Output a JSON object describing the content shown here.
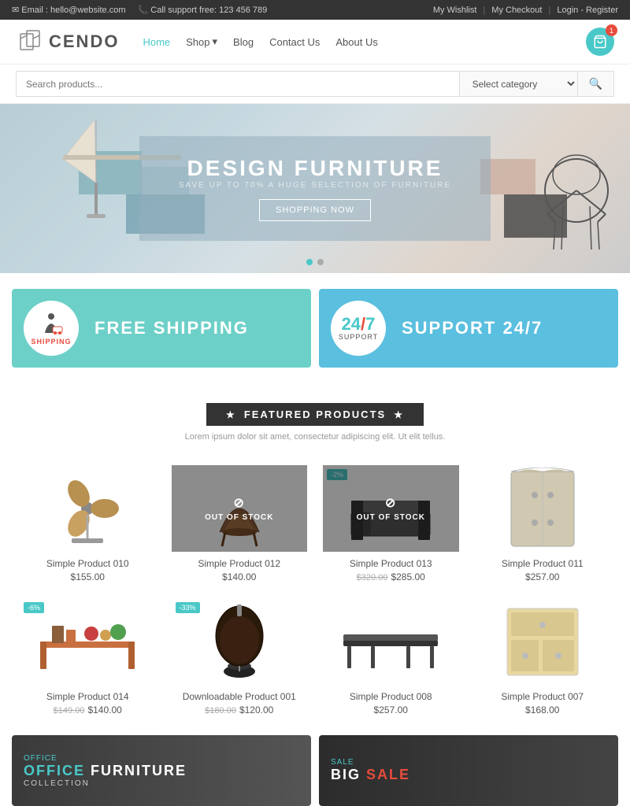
{
  "topbar": {
    "email_icon": "✉",
    "email_text": "Email : hello@website.com",
    "phone_icon": "📞",
    "phone_text": "Call support free: 123 456 789",
    "wishlist": "My Wishlist",
    "checkout": "My Checkout",
    "login": "Login - Register"
  },
  "header": {
    "logo_text": "CENDO",
    "cart_count": "1"
  },
  "nav": {
    "home": "Home",
    "shop": "Shop",
    "blog": "Blog",
    "contact": "Contact Us",
    "about": "About Us"
  },
  "search": {
    "placeholder": "Search products...",
    "category_default": "Select category",
    "search_icon": "🔍"
  },
  "hero": {
    "title": "DESIGN FURNITURE",
    "subtitle": "SAVE UP TO 70% A HUGE SELECTION OF FURNITURE",
    "cta": "SHOPPING NOW"
  },
  "features": {
    "shipping_text": "FREE SHIPPING",
    "shipping_icon_label": "SHIPPING",
    "support_text": "SUPPORT 24/7",
    "support_clock": "24/7",
    "support_label": "SUPPORT"
  },
  "featured": {
    "section_title": "FEATURED PRODUCTS",
    "section_desc": "Lorem ipsum dolor sit amet, consectetur adipiscing elit. Ut elit tellus."
  },
  "products": [
    {
      "id": "p1",
      "name": "Simple Product 010",
      "price": "$155.00",
      "old_price": null,
      "badge": null,
      "out_of_stock": false,
      "type": "fan"
    },
    {
      "id": "p2",
      "name": "Simple Product 012",
      "price": "$140.00",
      "old_price": null,
      "badge": null,
      "out_of_stock": true,
      "type": "chair"
    },
    {
      "id": "p3",
      "name": "Simple Product 013",
      "price": "$285.00",
      "old_price": "$320.00",
      "badge": "-2%",
      "out_of_stock": true,
      "type": "bed"
    },
    {
      "id": "p4",
      "name": "Simple Product 011",
      "price": "$257.00",
      "old_price": null,
      "badge": null,
      "out_of_stock": false,
      "type": "cabinet"
    },
    {
      "id": "p5",
      "name": "Simple Product 014",
      "price": "$140.00",
      "old_price": "$149.00",
      "badge": "-6%",
      "out_of_stock": false,
      "type": "shelf"
    },
    {
      "id": "p6",
      "name": "Downloadable Product 001",
      "price": "$120.00",
      "old_price": "$180.00",
      "badge": "-33%",
      "out_of_stock": false,
      "type": "lamp"
    },
    {
      "id": "p7",
      "name": "Simple Product 008",
      "price": "$257.00",
      "old_price": null,
      "badge": null,
      "out_of_stock": false,
      "type": "table"
    },
    {
      "id": "p8",
      "name": "Simple Product 007",
      "price": "$168.00",
      "old_price": null,
      "badge": null,
      "out_of_stock": false,
      "type": "dresser"
    }
  ],
  "banners": [
    {
      "tag": "OFFICE",
      "title_start": "OFFICE ",
      "title_highlight": "FURNITURE",
      "title_end": "",
      "subtitle": "COLLECTION"
    },
    {
      "tag": "SALE",
      "title_start": "BIG ",
      "title_highlight": "SALE",
      "title_end": ""
    }
  ]
}
